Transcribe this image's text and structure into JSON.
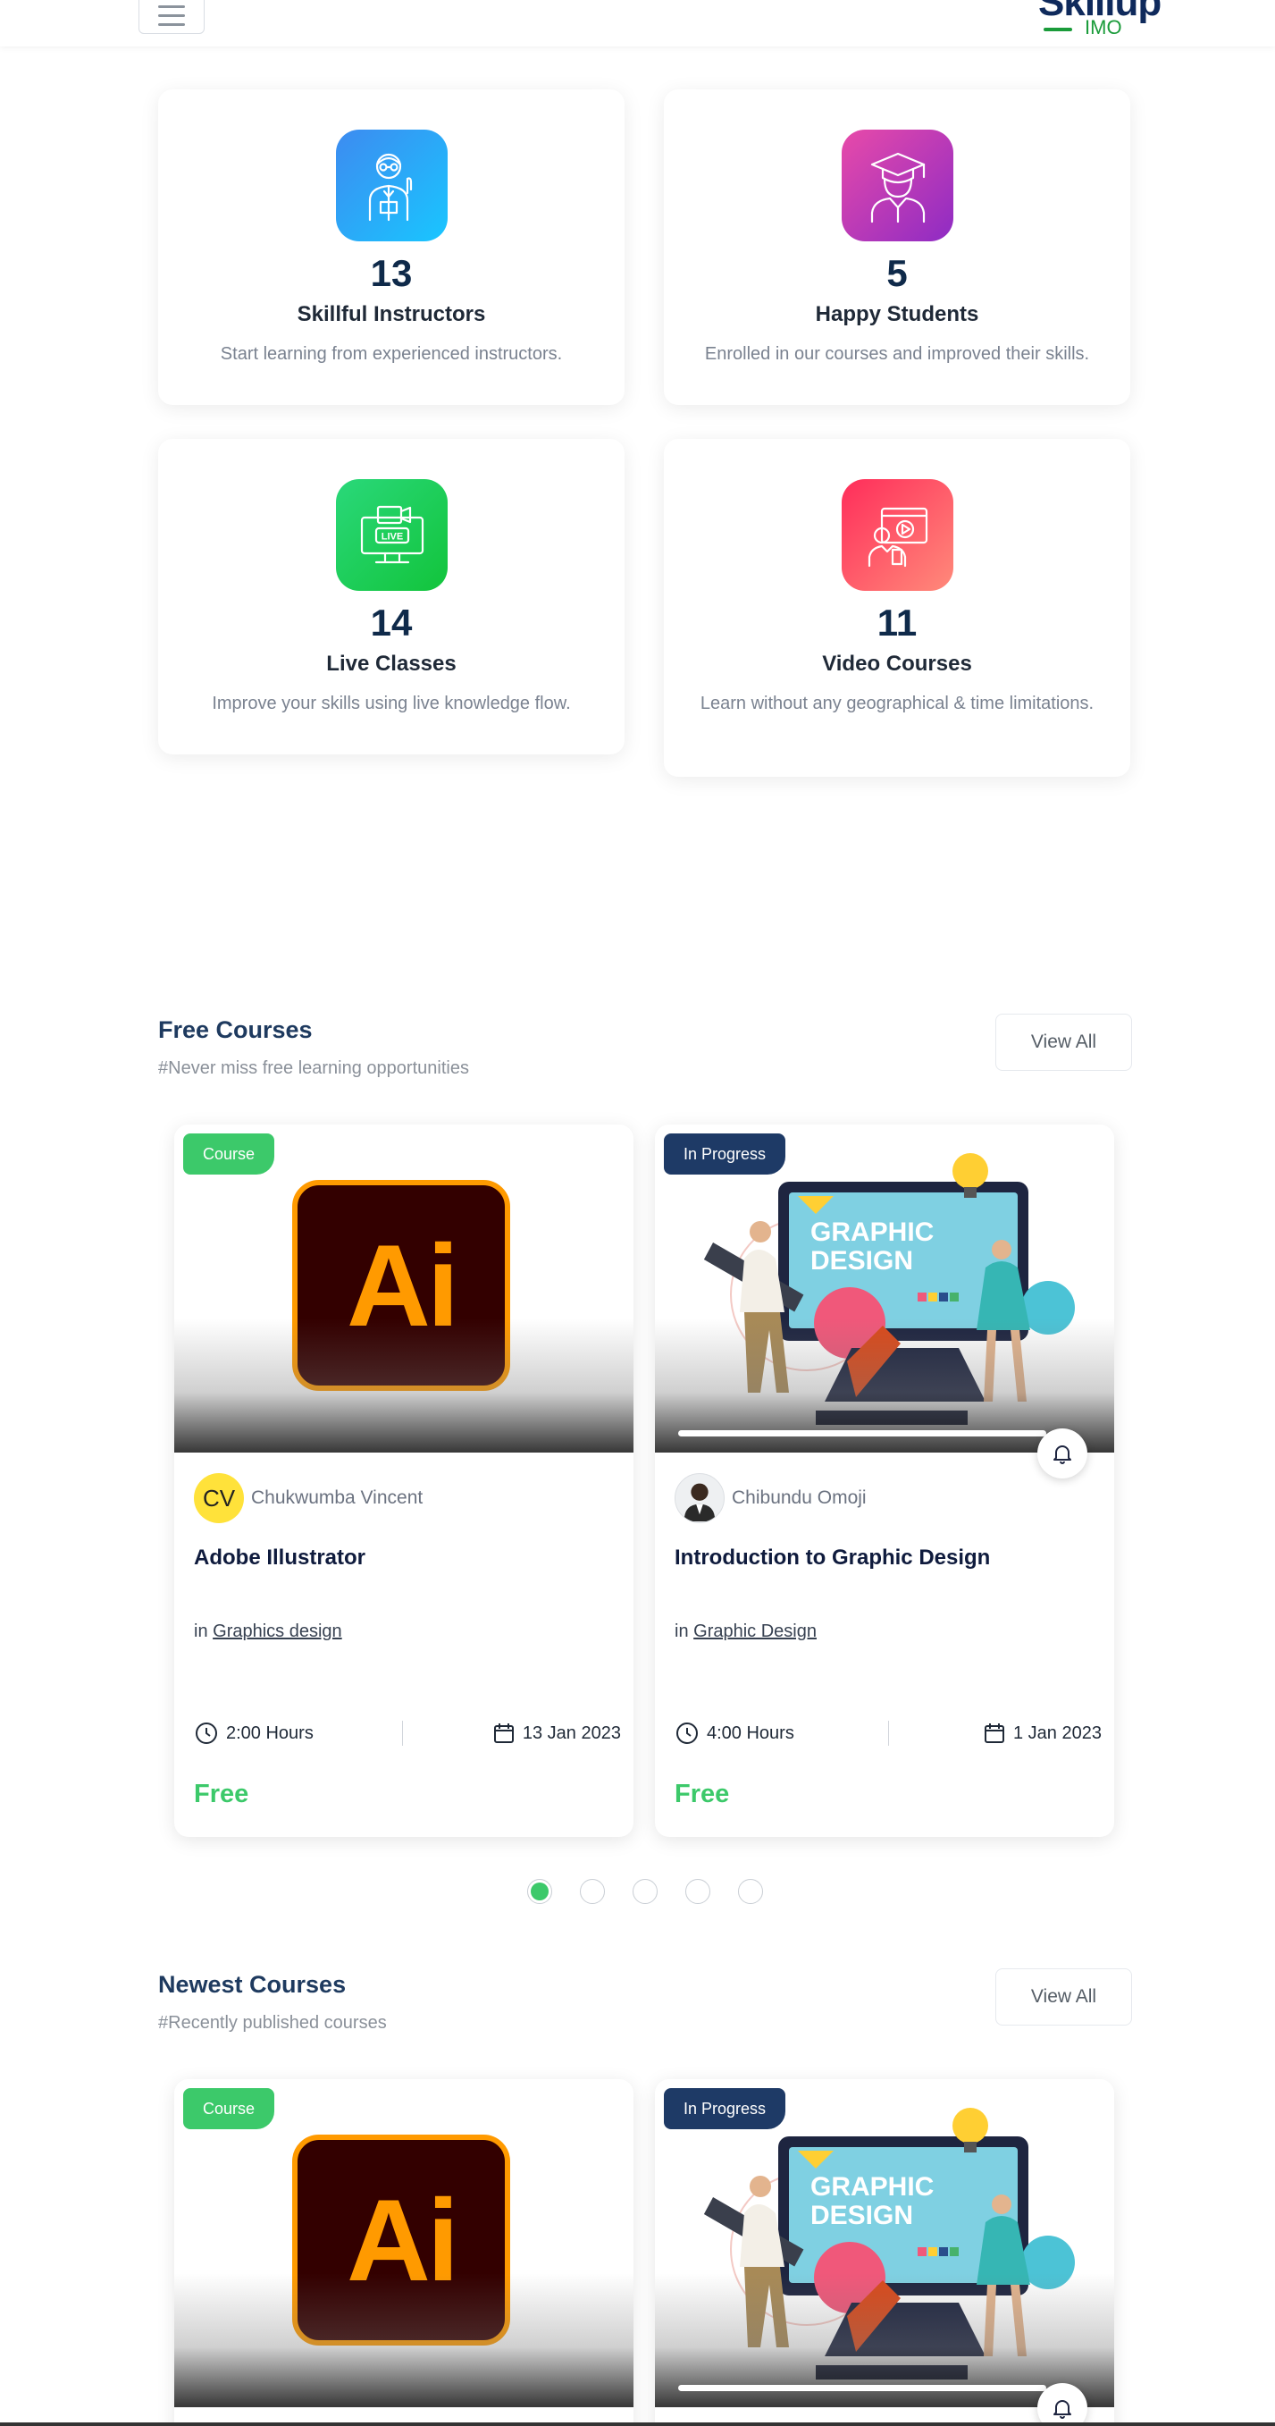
{
  "header": {
    "logo_main": "Skillup",
    "logo_sub": "IMO"
  },
  "stats": [
    {
      "number": "13",
      "title": "Skillful Instructors",
      "desc": "Start learning from experienced instructors.",
      "icon": "instructor-icon",
      "gradient": [
        "#3d8bf0",
        "#19c6ff"
      ]
    },
    {
      "number": "5",
      "title": "Happy Students",
      "desc": "Enrolled in our courses and improved their skills.",
      "icon": "graduate-icon",
      "gradient": [
        "#e84aa9",
        "#8e2bc4"
      ]
    },
    {
      "number": "14",
      "title": "Live Classes",
      "desc": "Improve your skills using live knowledge flow.",
      "icon": "live-class-icon",
      "gradient": [
        "#2ad87a",
        "#12c43b"
      ]
    },
    {
      "number": "11",
      "title": "Video Courses",
      "desc": "Learn without any geographical & time limitations.",
      "icon": "video-course-icon",
      "gradient": [
        "#ff2d5a",
        "#ff8a7a"
      ]
    }
  ],
  "free_courses": {
    "title": "Free Courses",
    "subtitle": "#Never miss free learning opportunities",
    "view_all": "View All",
    "cards": [
      {
        "badge": "Course",
        "author": "Chukwumba Vincent",
        "author_initials": "CV",
        "title": "Adobe Illustrator",
        "category_prefix": "in",
        "category": "Graphics design",
        "duration": "2:00 Hours",
        "date": "13 Jan 2023",
        "price": "Free"
      },
      {
        "badge": "In Progress",
        "author": "Chibundu Omoji",
        "title": "Introduction to Graphic Design",
        "category_prefix": "in",
        "category": "Graphic Design",
        "duration": "4:00 Hours",
        "date": "1 Jan 2023",
        "price": "Free"
      }
    ]
  },
  "newest_courses": {
    "title": "Newest Courses",
    "subtitle": "#Recently published courses",
    "view_all": "View All",
    "cards": [
      {
        "badge": "Course"
      },
      {
        "badge": "In Progress"
      }
    ]
  },
  "graphic_design_art_text": [
    "GRAPHIC",
    "DESIGN"
  ],
  "ai_logo_text": "Ai",
  "carousel": {
    "total": 5,
    "active": 1
  },
  "colors": {
    "accent_green": "#3cc96a",
    "navy": "#1e3a66"
  }
}
